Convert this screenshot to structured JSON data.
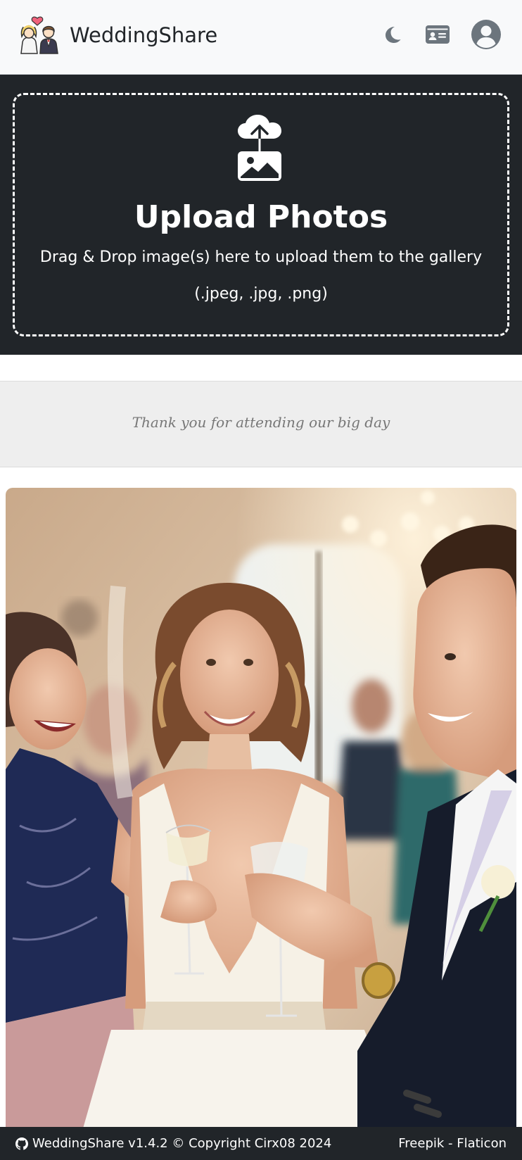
{
  "navbar": {
    "brand_name": "WeddingShare",
    "logo_icon": "bride-groom-icon",
    "theme_icon": "moon-icon",
    "id_icon": "id-card-icon",
    "account_icon": "user-circle-icon"
  },
  "upload": {
    "icon": "cloud-upload-image-icon",
    "title": "Upload Photos",
    "description": "Drag & Drop image(s) here to upload them to the gallery",
    "file_types": "(.jpeg, .jpg, .png)"
  },
  "banner": {
    "text": "Thank you for attending our big day"
  },
  "gallery": {
    "photo_icon": "wedding-guests-photo"
  },
  "footer": {
    "github_icon": "github-icon",
    "version_text": "WeddingShare v1.4.2 © Copyright Cirx08 2024",
    "credit_text": "Freepik - Flaticon"
  },
  "colors": {
    "navbar_bg": "#f8f9fa",
    "dark_bg": "#212529",
    "banner_bg": "#eeeeee",
    "banner_text": "#777777",
    "icon_gray": "#6c757d"
  }
}
